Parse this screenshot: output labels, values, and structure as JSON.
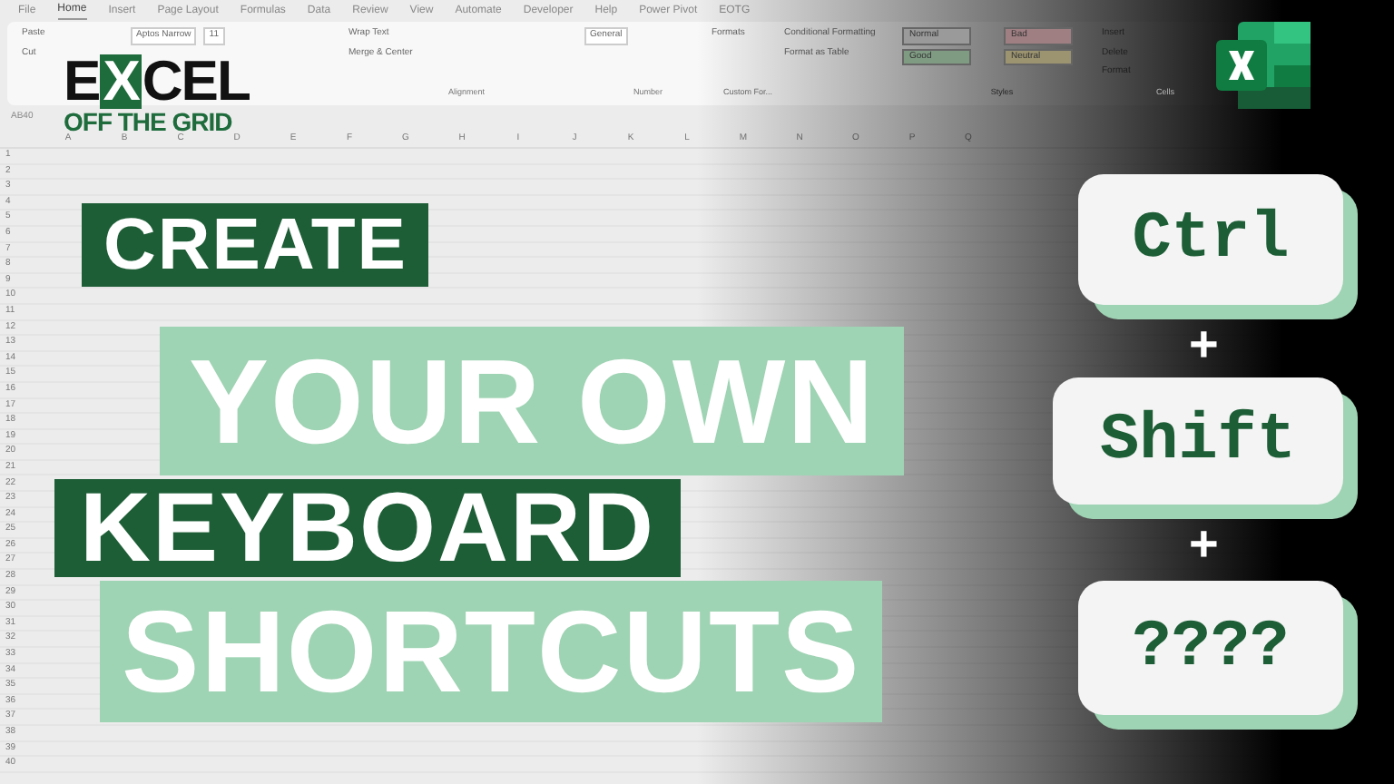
{
  "ribbon": {
    "tabs": [
      {
        "label": "File",
        "selected": false
      },
      {
        "label": "Home",
        "selected": true
      },
      {
        "label": "Insert",
        "selected": false
      },
      {
        "label": "Page Layout",
        "selected": false
      },
      {
        "label": "Formulas",
        "selected": false
      },
      {
        "label": "Data",
        "selected": false
      },
      {
        "label": "Review",
        "selected": false
      },
      {
        "label": "View",
        "selected": false
      },
      {
        "label": "Automate",
        "selected": false
      },
      {
        "label": "Developer",
        "selected": false
      },
      {
        "label": "Help",
        "selected": false
      },
      {
        "label": "Power Pivot",
        "selected": false
      },
      {
        "label": "EOTG",
        "selected": false
      }
    ],
    "groups": [
      {
        "kind": "buttons",
        "items": [
          {
            "label": "Paste"
          },
          {
            "label": "Cut"
          }
        ]
      },
      {
        "kind": "fields",
        "items": [
          {
            "label": "Aptos Narrow"
          },
          {
            "label": "11"
          }
        ]
      },
      {
        "kind": "buttons",
        "items": [
          {
            "label": "Wrap Text"
          },
          {
            "label": "Merge & Center"
          }
        ],
        "caption": "Alignment"
      },
      {
        "kind": "fields",
        "items": [
          {
            "label": "General"
          }
        ],
        "caption": "Number"
      },
      {
        "kind": "buttons",
        "items": [
          {
            "label": "Formats"
          }
        ],
        "caption": "Custom For..."
      },
      {
        "kind": "buttons",
        "items": [
          {
            "label": "Conditional Formatting"
          },
          {
            "label": "Format as Table"
          }
        ]
      },
      {
        "kind": "styles",
        "items": [
          {
            "label": "Normal",
            "color": "#9a9a9a"
          },
          {
            "label": "Bad",
            "color": "#a07f83"
          },
          {
            "label": "Good",
            "color": "#7f9c83"
          },
          {
            "label": "Neutral",
            "color": "#9c9470"
          }
        ],
        "caption": "Styles"
      },
      {
        "kind": "buttons",
        "items": [
          {
            "label": "Insert"
          },
          {
            "label": "Delete"
          },
          {
            "label": "Format"
          }
        ],
        "caption": "Cells"
      }
    ]
  },
  "name_box": "AB40",
  "grid": {
    "columns": [
      "A",
      "B",
      "C",
      "D",
      "E",
      "F",
      "G",
      "H",
      "I",
      "J",
      "K",
      "L",
      "M",
      "N",
      "O",
      "P",
      "Q"
    ],
    "rows": [
      "1",
      "2",
      "3",
      "4",
      "5",
      "6",
      "7",
      "8",
      "9",
      "10",
      "11",
      "12",
      "13",
      "14",
      "15",
      "16",
      "17",
      "18",
      "19",
      "20",
      "21",
      "22",
      "23",
      "24",
      "25",
      "26",
      "27",
      "28",
      "29",
      "30",
      "31",
      "32",
      "33",
      "34",
      "35",
      "36",
      "37",
      "38",
      "39",
      "40"
    ]
  },
  "logo": {
    "word_parts": [
      {
        "text": "E",
        "highlight": false
      },
      {
        "text": "X",
        "highlight": true
      },
      {
        "text": "CEL",
        "highlight": false
      }
    ],
    "tagline": "OFF THE GRID"
  },
  "title_lines": [
    {
      "text": "CREATE",
      "kind": "dark"
    },
    {
      "text": "YOUR OWN",
      "kind": "light"
    },
    {
      "text": "KEYBOARD",
      "kind": "dark"
    },
    {
      "text": "SHORTCUTS",
      "kind": "light"
    }
  ],
  "keys": [
    {
      "label": "Ctrl"
    },
    {
      "label": "Shift"
    },
    {
      "label": "????"
    }
  ],
  "separators": [
    "+",
    "+"
  ]
}
